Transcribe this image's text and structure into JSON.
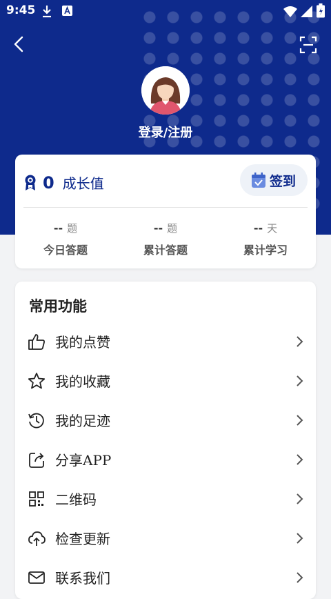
{
  "status_bar": {
    "time": "9:45"
  },
  "header": {
    "login_label": "登录/注册"
  },
  "growth": {
    "value": "0",
    "label": "成长值",
    "signin_label": "签到"
  },
  "stats": [
    {
      "value": "--",
      "unit": "题",
      "label": "今日答题"
    },
    {
      "value": "--",
      "unit": "题",
      "label": "累计答题"
    },
    {
      "value": "--",
      "unit": "天",
      "label": "累计学习"
    }
  ],
  "functions": {
    "title": "常用功能",
    "items": [
      {
        "label": "我的点赞",
        "icon": "thumbs-up-icon"
      },
      {
        "label": "我的收藏",
        "icon": "star-icon"
      },
      {
        "label": "我的足迹",
        "icon": "history-icon"
      },
      {
        "label": "分享APP",
        "icon": "share-icon"
      },
      {
        "label": "二维码",
        "icon": "qrcode-icon"
      },
      {
        "label": "检查更新",
        "icon": "cloud-upload-icon"
      },
      {
        "label": "联系我们",
        "icon": "mail-icon"
      }
    ]
  },
  "colors": {
    "primary": "#0e2a8c",
    "background": "#f2f3f5"
  }
}
